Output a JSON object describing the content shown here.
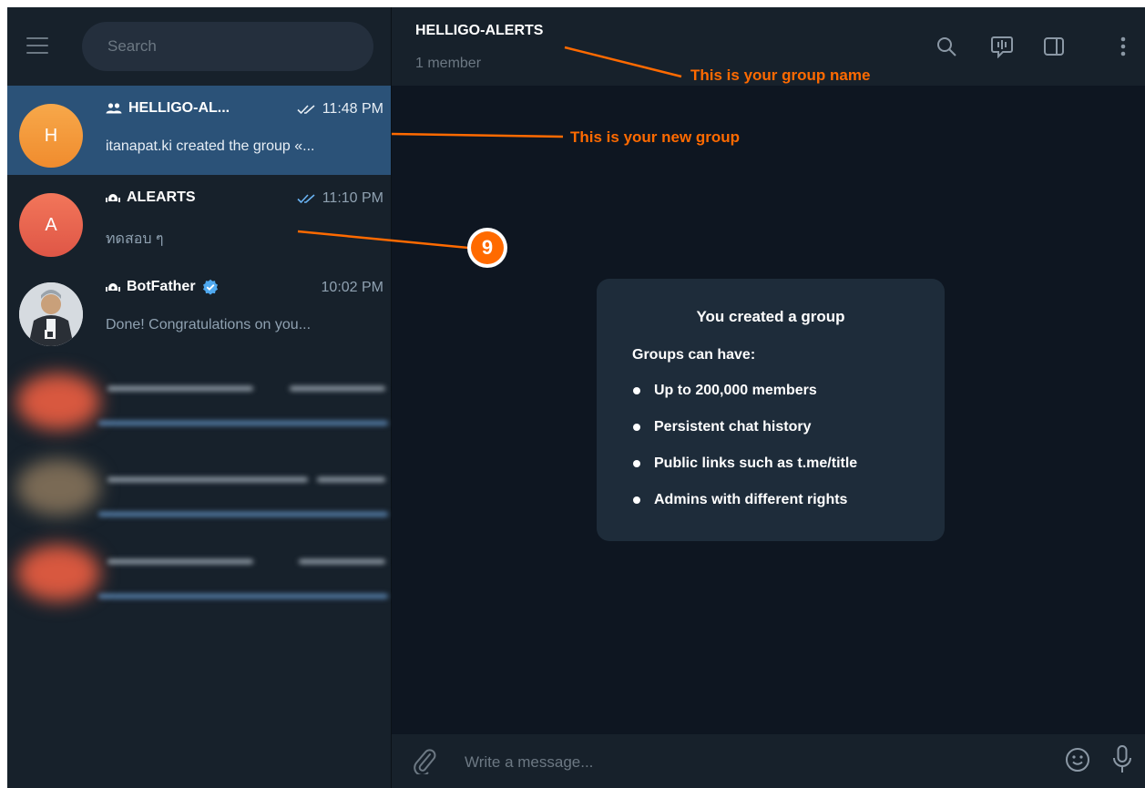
{
  "sidebar": {
    "menu_icon": "hamburger-icon",
    "search": {
      "placeholder": "Search",
      "value": ""
    },
    "chats": [
      {
        "name": "HELLIGO-AL...",
        "type_icon": "group-icon",
        "time": "11:48 PM",
        "status_icon": "double-check-icon",
        "preview": "itanapat.ki created the group «...",
        "avatar_letter": "H",
        "active": true
      },
      {
        "name": "ALEARTS",
        "type_icon": "channel-icon",
        "time": "11:10 PM",
        "status_icon": "double-check-icon",
        "preview": "ทดสอบ ๆ",
        "avatar_letter": "A",
        "active": false
      },
      {
        "name": "BotFather",
        "type_icon": "bot-icon",
        "verified_icon": "verified-badge-icon",
        "time": "10:02 PM",
        "preview": "Done! Congratulations on you...",
        "avatar_image": "botfather-avatar",
        "active": false
      }
    ]
  },
  "header": {
    "title": "HELLIGO-ALERTS",
    "subtitle": "1 member",
    "icons": [
      "search-icon",
      "voice-chat-icon",
      "sidebar-toggle-icon",
      "more-options-icon"
    ]
  },
  "service_message": {
    "title": "You created a group",
    "subtitle": "Groups can have:",
    "items": [
      "Up to 200,000 members",
      "Persistent chat history",
      "Public links such as t.me/title",
      "Admins with different rights"
    ]
  },
  "composer": {
    "placeholder": "Write a message...",
    "attach_icon": "paperclip-icon",
    "emoji_icon": "emoji-icon",
    "mic_icon": "microphone-icon"
  },
  "annotations": {
    "group_name_label": "This is your group name",
    "new_group_label": "This is your new group",
    "step_number": "9",
    "color": "#ff6a00"
  },
  "colors": {
    "sidebar_bg": "#17212b",
    "chat_bg": "#0e1621",
    "active_chat_bg": "#2b5278",
    "card_bg": "#1e2c3a",
    "muted_text": "#6c7883",
    "annotation": "#ff6a00",
    "check_color": "#6ab3f3"
  }
}
